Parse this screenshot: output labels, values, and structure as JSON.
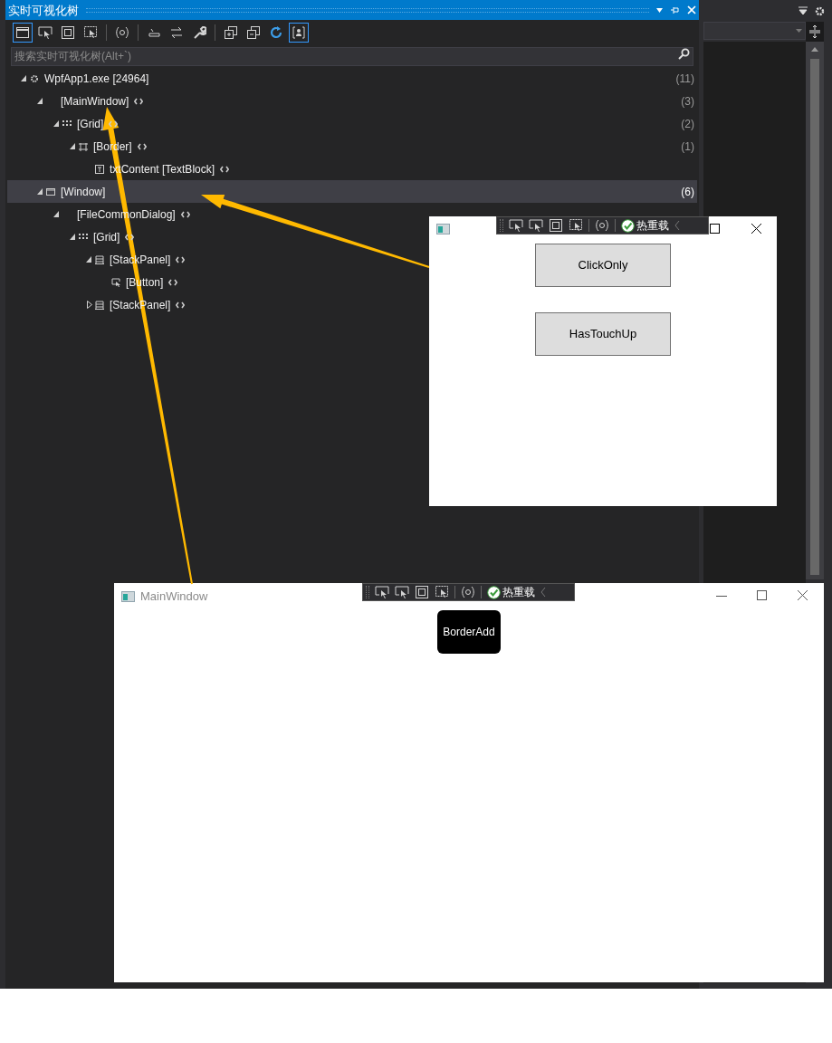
{
  "panel": {
    "title": "实时可视化树",
    "search": {
      "placeholder": "搜索实时可视化树(Alt+`)"
    },
    "toolbar": [
      {
        "selected": true
      },
      {
        "selected": false
      },
      {
        "selected": false
      },
      {
        "selected": false
      },
      {
        "selected": false
      },
      {
        "selected": false
      },
      {
        "selected": false
      },
      {
        "selected": false
      },
      {
        "selected": false
      },
      {
        "selected": false
      },
      {
        "selected": false
      },
      {
        "selected": true
      }
    ],
    "tree": [
      {
        "kind": "process",
        "label": "WpfApp1.exe [24964]",
        "count": "(11)",
        "expanded": true,
        "selected": false,
        "source": false,
        "children": [
          {
            "kind": "element",
            "label": "[MainWindow]",
            "count": "(3)",
            "expanded": true,
            "selected": false,
            "source": true,
            "children": [
              {
                "kind": "grid",
                "label": "[Grid]",
                "count": "(2)",
                "expanded": true,
                "selected": false,
                "source": true,
                "children": [
                  {
                    "kind": "border",
                    "label": "[Border]",
                    "count": "(1)",
                    "expanded": true,
                    "selected": false,
                    "source": true,
                    "children": [
                      {
                        "kind": "text",
                        "label": "txtContent [TextBlock]",
                        "selected": false,
                        "source": true
                      }
                    ]
                  }
                ]
              }
            ]
          },
          {
            "kind": "window",
            "label": "[Window]",
            "count": "(6)",
            "expanded": true,
            "selected": true,
            "source": false,
            "children": [
              {
                "kind": "element",
                "label": "[FileCommonDialog]",
                "expanded": true,
                "selected": false,
                "source": true,
                "children": [
                  {
                    "kind": "grid",
                    "label": "[Grid]",
                    "expanded": true,
                    "selected": false,
                    "source": true,
                    "children": [
                      {
                        "kind": "stack",
                        "label": "[StackPanel]",
                        "expanded": true,
                        "selected": false,
                        "source": true,
                        "children": [
                          {
                            "kind": "button",
                            "label": "[Button]",
                            "selected": false,
                            "source": true
                          }
                        ]
                      },
                      {
                        "kind": "stack",
                        "label": "[StackPanel]",
                        "expanded": false,
                        "selected": false,
                        "source": true
                      }
                    ]
                  }
                ]
              }
            ]
          }
        ]
      }
    ]
  },
  "dialog_window": {
    "hot_reload": "热重载",
    "buttons": [
      "ClickOnly",
      "HasTouchUp"
    ]
  },
  "main_window": {
    "title": "MainWindow",
    "hot_reload": "热重载",
    "border_button": "BorderAdd"
  }
}
